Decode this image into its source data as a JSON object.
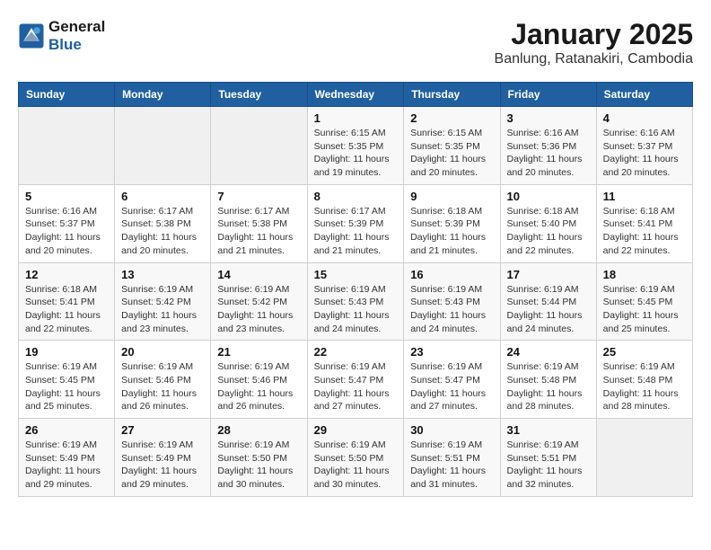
{
  "header": {
    "logo_line1": "General",
    "logo_line2": "Blue",
    "month": "January 2025",
    "location": "Banlung, Ratanakiri, Cambodia"
  },
  "weekdays": [
    "Sunday",
    "Monday",
    "Tuesday",
    "Wednesday",
    "Thursday",
    "Friday",
    "Saturday"
  ],
  "weeks": [
    [
      {
        "day": "",
        "sunrise": "",
        "sunset": "",
        "daylight": ""
      },
      {
        "day": "",
        "sunrise": "",
        "sunset": "",
        "daylight": ""
      },
      {
        "day": "",
        "sunrise": "",
        "sunset": "",
        "daylight": ""
      },
      {
        "day": "1",
        "sunrise": "Sunrise: 6:15 AM",
        "sunset": "Sunset: 5:35 PM",
        "daylight": "Daylight: 11 hours and 19 minutes."
      },
      {
        "day": "2",
        "sunrise": "Sunrise: 6:15 AM",
        "sunset": "Sunset: 5:35 PM",
        "daylight": "Daylight: 11 hours and 20 minutes."
      },
      {
        "day": "3",
        "sunrise": "Sunrise: 6:16 AM",
        "sunset": "Sunset: 5:36 PM",
        "daylight": "Daylight: 11 hours and 20 minutes."
      },
      {
        "day": "4",
        "sunrise": "Sunrise: 6:16 AM",
        "sunset": "Sunset: 5:37 PM",
        "daylight": "Daylight: 11 hours and 20 minutes."
      }
    ],
    [
      {
        "day": "5",
        "sunrise": "Sunrise: 6:16 AM",
        "sunset": "Sunset: 5:37 PM",
        "daylight": "Daylight: 11 hours and 20 minutes."
      },
      {
        "day": "6",
        "sunrise": "Sunrise: 6:17 AM",
        "sunset": "Sunset: 5:38 PM",
        "daylight": "Daylight: 11 hours and 20 minutes."
      },
      {
        "day": "7",
        "sunrise": "Sunrise: 6:17 AM",
        "sunset": "Sunset: 5:38 PM",
        "daylight": "Daylight: 11 hours and 21 minutes."
      },
      {
        "day": "8",
        "sunrise": "Sunrise: 6:17 AM",
        "sunset": "Sunset: 5:39 PM",
        "daylight": "Daylight: 11 hours and 21 minutes."
      },
      {
        "day": "9",
        "sunrise": "Sunrise: 6:18 AM",
        "sunset": "Sunset: 5:39 PM",
        "daylight": "Daylight: 11 hours and 21 minutes."
      },
      {
        "day": "10",
        "sunrise": "Sunrise: 6:18 AM",
        "sunset": "Sunset: 5:40 PM",
        "daylight": "Daylight: 11 hours and 22 minutes."
      },
      {
        "day": "11",
        "sunrise": "Sunrise: 6:18 AM",
        "sunset": "Sunset: 5:41 PM",
        "daylight": "Daylight: 11 hours and 22 minutes."
      }
    ],
    [
      {
        "day": "12",
        "sunrise": "Sunrise: 6:18 AM",
        "sunset": "Sunset: 5:41 PM",
        "daylight": "Daylight: 11 hours and 22 minutes."
      },
      {
        "day": "13",
        "sunrise": "Sunrise: 6:19 AM",
        "sunset": "Sunset: 5:42 PM",
        "daylight": "Daylight: 11 hours and 23 minutes."
      },
      {
        "day": "14",
        "sunrise": "Sunrise: 6:19 AM",
        "sunset": "Sunset: 5:42 PM",
        "daylight": "Daylight: 11 hours and 23 minutes."
      },
      {
        "day": "15",
        "sunrise": "Sunrise: 6:19 AM",
        "sunset": "Sunset: 5:43 PM",
        "daylight": "Daylight: 11 hours and 24 minutes."
      },
      {
        "day": "16",
        "sunrise": "Sunrise: 6:19 AM",
        "sunset": "Sunset: 5:43 PM",
        "daylight": "Daylight: 11 hours and 24 minutes."
      },
      {
        "day": "17",
        "sunrise": "Sunrise: 6:19 AM",
        "sunset": "Sunset: 5:44 PM",
        "daylight": "Daylight: 11 hours and 24 minutes."
      },
      {
        "day": "18",
        "sunrise": "Sunrise: 6:19 AM",
        "sunset": "Sunset: 5:45 PM",
        "daylight": "Daylight: 11 hours and 25 minutes."
      }
    ],
    [
      {
        "day": "19",
        "sunrise": "Sunrise: 6:19 AM",
        "sunset": "Sunset: 5:45 PM",
        "daylight": "Daylight: 11 hours and 25 minutes."
      },
      {
        "day": "20",
        "sunrise": "Sunrise: 6:19 AM",
        "sunset": "Sunset: 5:46 PM",
        "daylight": "Daylight: 11 hours and 26 minutes."
      },
      {
        "day": "21",
        "sunrise": "Sunrise: 6:19 AM",
        "sunset": "Sunset: 5:46 PM",
        "daylight": "Daylight: 11 hours and 26 minutes."
      },
      {
        "day": "22",
        "sunrise": "Sunrise: 6:19 AM",
        "sunset": "Sunset: 5:47 PM",
        "daylight": "Daylight: 11 hours and 27 minutes."
      },
      {
        "day": "23",
        "sunrise": "Sunrise: 6:19 AM",
        "sunset": "Sunset: 5:47 PM",
        "daylight": "Daylight: 11 hours and 27 minutes."
      },
      {
        "day": "24",
        "sunrise": "Sunrise: 6:19 AM",
        "sunset": "Sunset: 5:48 PM",
        "daylight": "Daylight: 11 hours and 28 minutes."
      },
      {
        "day": "25",
        "sunrise": "Sunrise: 6:19 AM",
        "sunset": "Sunset: 5:48 PM",
        "daylight": "Daylight: 11 hours and 28 minutes."
      }
    ],
    [
      {
        "day": "26",
        "sunrise": "Sunrise: 6:19 AM",
        "sunset": "Sunset: 5:49 PM",
        "daylight": "Daylight: 11 hours and 29 minutes."
      },
      {
        "day": "27",
        "sunrise": "Sunrise: 6:19 AM",
        "sunset": "Sunset: 5:49 PM",
        "daylight": "Daylight: 11 hours and 29 minutes."
      },
      {
        "day": "28",
        "sunrise": "Sunrise: 6:19 AM",
        "sunset": "Sunset: 5:50 PM",
        "daylight": "Daylight: 11 hours and 30 minutes."
      },
      {
        "day": "29",
        "sunrise": "Sunrise: 6:19 AM",
        "sunset": "Sunset: 5:50 PM",
        "daylight": "Daylight: 11 hours and 30 minutes."
      },
      {
        "day": "30",
        "sunrise": "Sunrise: 6:19 AM",
        "sunset": "Sunset: 5:51 PM",
        "daylight": "Daylight: 11 hours and 31 minutes."
      },
      {
        "day": "31",
        "sunrise": "Sunrise: 6:19 AM",
        "sunset": "Sunset: 5:51 PM",
        "daylight": "Daylight: 11 hours and 32 minutes."
      },
      {
        "day": "",
        "sunrise": "",
        "sunset": "",
        "daylight": ""
      }
    ]
  ]
}
